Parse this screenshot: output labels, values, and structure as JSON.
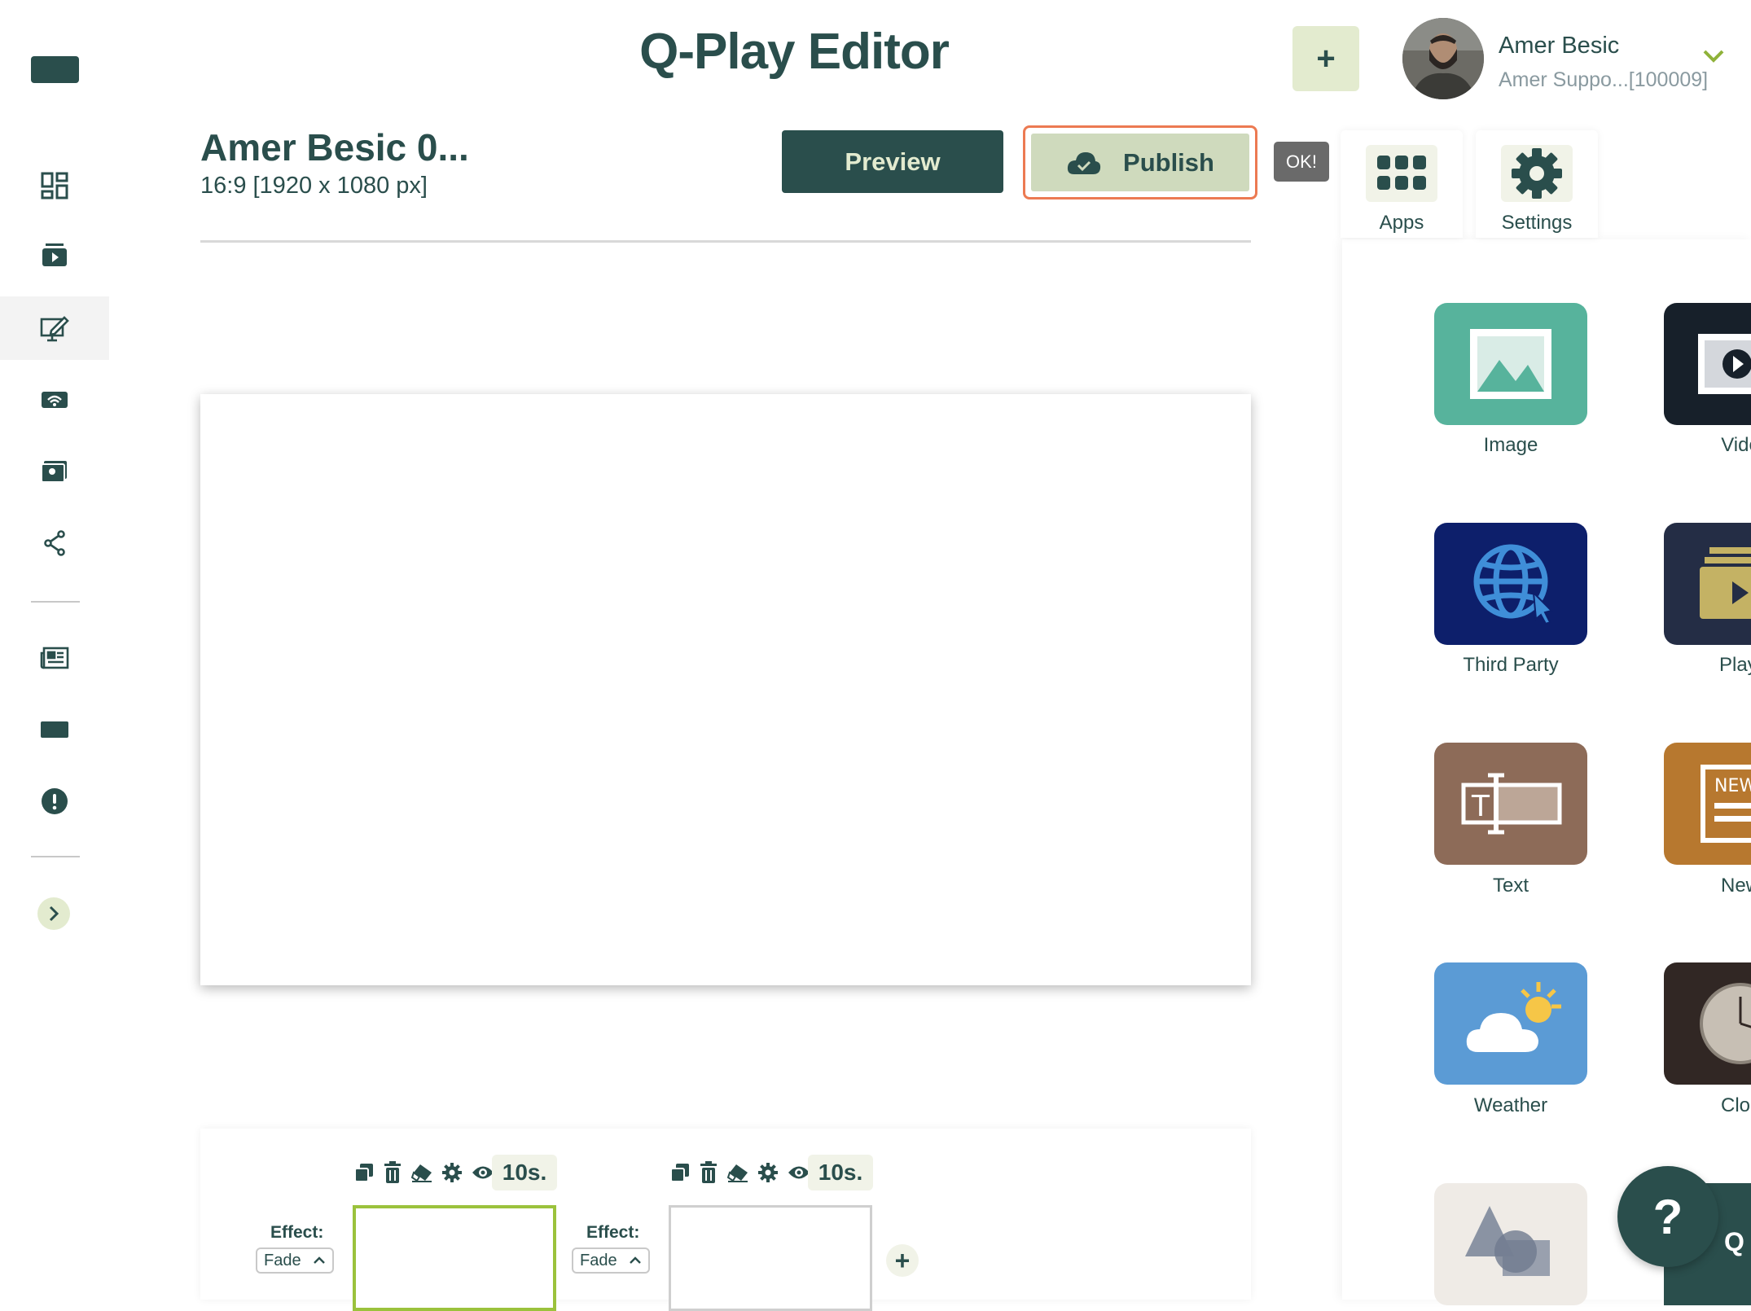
{
  "header": {
    "app_title": "Q-Play Editor",
    "add_label": "+"
  },
  "user": {
    "name": "Amer Besic",
    "subtitle": "Amer Suppo...[100009]"
  },
  "presentation": {
    "name": "Amer Besic 0...",
    "size": "16:9 [1920 x 1080 px]"
  },
  "actions": {
    "preview_label": "Preview",
    "publish_label": "Publish",
    "ok_label": "OK!"
  },
  "tabs": [
    {
      "label": "Apps"
    },
    {
      "label": "Settings"
    }
  ],
  "apps": [
    {
      "label": "Image",
      "color": "#57b39c"
    },
    {
      "label": "Vide",
      "color": "#17202a"
    },
    {
      "label": "Third Party",
      "color": "#0d1f6b"
    },
    {
      "label": "Playl",
      "color": "#242d45"
    },
    {
      "label": "Text",
      "color": "#8d6b58"
    },
    {
      "label": "New",
      "color": "#b7782f"
    },
    {
      "label": "Weather",
      "color": "#5b9bd5"
    },
    {
      "label": "Cloc",
      "color": "#312724"
    },
    {
      "label": "",
      "color": "#efebe6"
    },
    {
      "label": "Q",
      "color": "#2a4e4c"
    }
  ],
  "timeline": {
    "slides": [
      {
        "duration": "10s.",
        "effect_label": "Effect:",
        "effect_value": "Fade",
        "selected": true
      },
      {
        "duration": "10s.",
        "effect_label": "Effect:",
        "effect_value": "Fade",
        "selected": false
      }
    ],
    "add_label": "+"
  },
  "help_label": "?",
  "colors": {
    "primary": "#2a4e4c",
    "accent_light": "#e3ebcf",
    "publish_border": "#ec7a52",
    "selected_slide": "#9bc23c"
  }
}
